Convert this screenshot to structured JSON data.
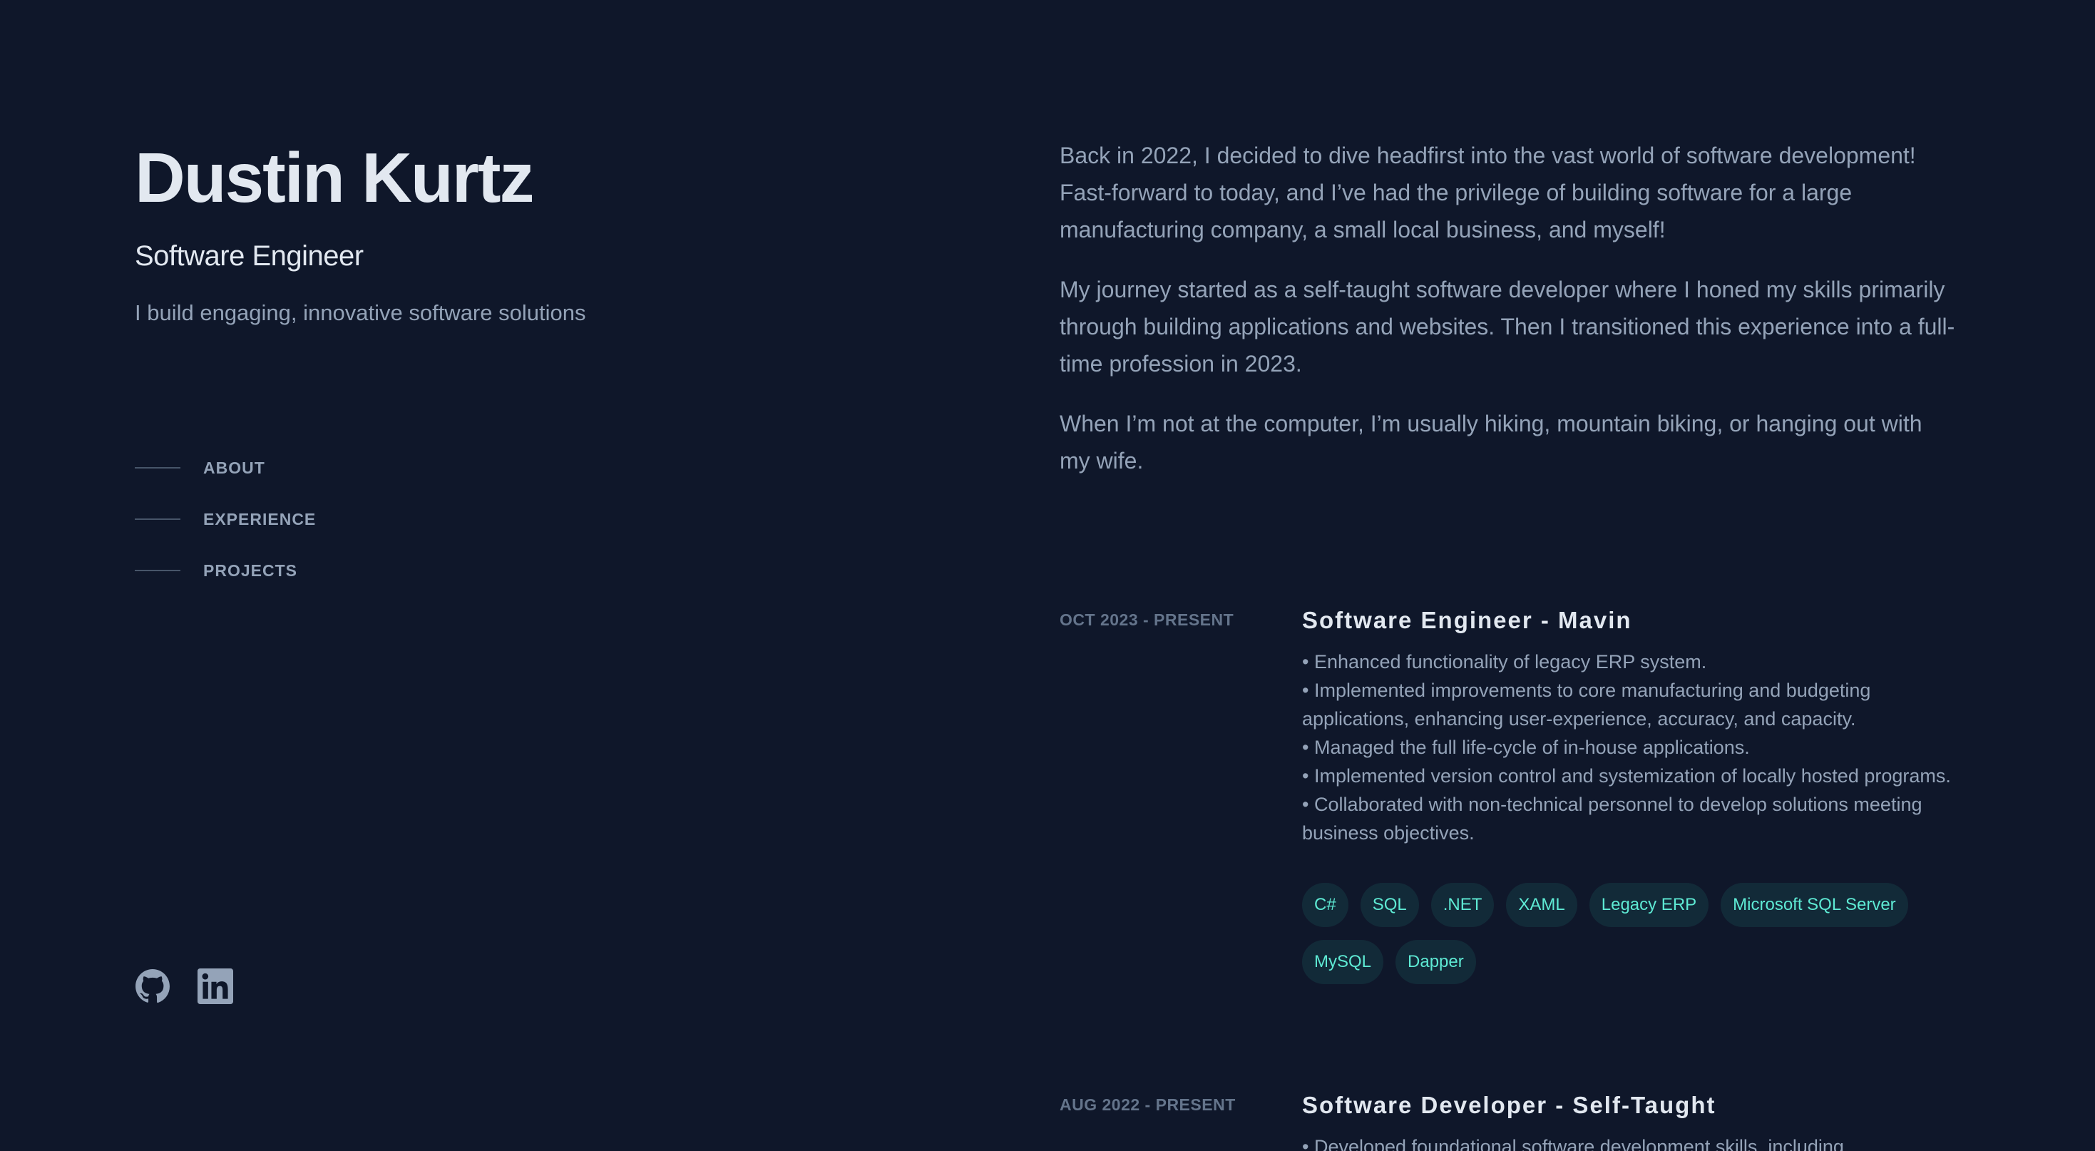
{
  "header": {
    "name": "Dustin Kurtz",
    "role": "Software Engineer",
    "tagline": "I build engaging, innovative software solutions"
  },
  "nav": {
    "items": [
      {
        "label": "ABOUT"
      },
      {
        "label": "EXPERIENCE"
      },
      {
        "label": "PROJECTS"
      }
    ]
  },
  "socials": {
    "items": [
      {
        "icon": "github-icon"
      },
      {
        "icon": "linkedin-icon"
      }
    ]
  },
  "about": {
    "paragraphs": [
      "Back in 2022, I decided to dive headfirst into the vast world of software development! Fast-forward to today, and I’ve had the privilege of building software for a large manufacturing company, a small local business, and myself!",
      "My journey started as a self-taught software developer where I honed my skills primarily through building applications and websites. Then I transitioned this experience into a full-time profession in 2023.",
      "When I’m not at the computer, I’m usually hiking, mountain biking, or hanging out with my wife."
    ]
  },
  "experience": {
    "items": [
      {
        "date": "Oct 2023 - PRESENT",
        "title": "Software Engineer - Mavin",
        "description": "• Enhanced functionality of legacy ERP system.\n• Implemented improvements to core manufacturing and budgeting applications, enhancing user-experience, accuracy, and capacity.\n• Managed the full life-cycle of in-house applications.\n• Implemented version control and systemization of locally hosted programs.\n• Collaborated with non-technical personnel to develop solutions meeting business objectives.",
        "tags": [
          "C#",
          "SQL",
          ".NET",
          "XAML",
          "Legacy ERP",
          "Microsoft SQL Server",
          "MySQL",
          "Dapper"
        ]
      },
      {
        "date": "Aug 2022 - PRESENT",
        "title": "Software Developer - Self-Taught",
        "description": "• Developed foundational software development skills, including"
      }
    ]
  },
  "colors": {
    "background": "#0f172a",
    "heading": "#e2e8f0",
    "body": "#94a3b8",
    "muted": "#64748b",
    "accent": "#5eead4"
  }
}
